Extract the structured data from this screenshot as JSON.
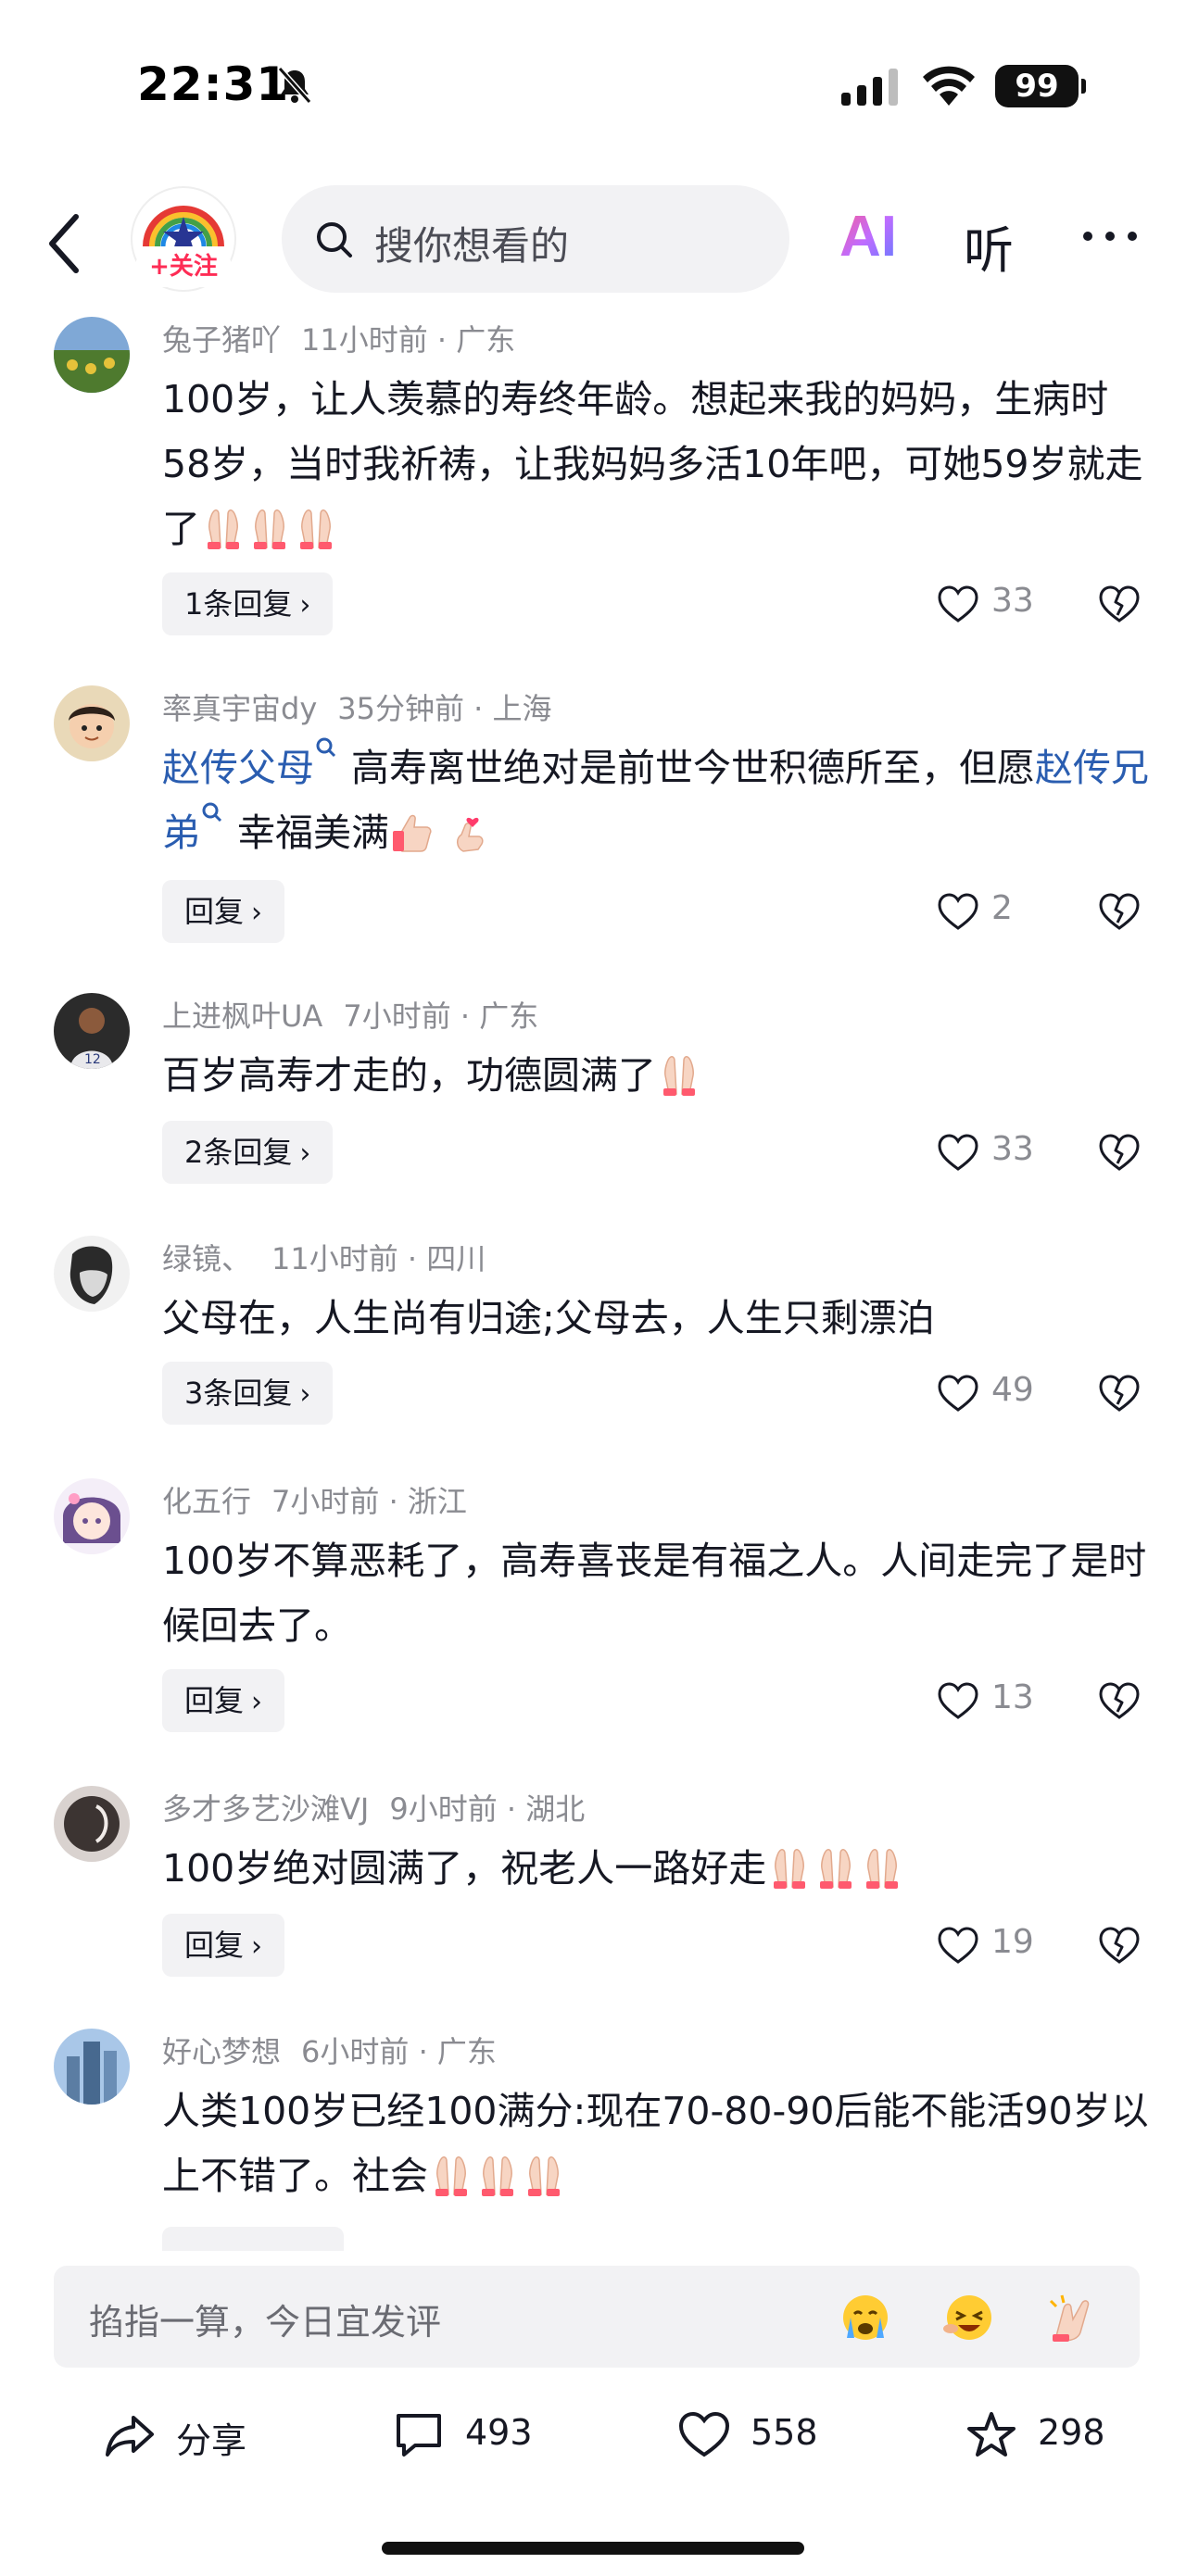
{
  "status_bar": {
    "time": "22:31",
    "battery": "99"
  },
  "top_nav": {
    "follow_label": "+关注",
    "search_placeholder": "搜你想看的",
    "ai_label": "AI",
    "listen_label": "听"
  },
  "comments": [
    {
      "author": "兔子猪吖",
      "time": "11小时前",
      "region": "广东",
      "text": "100岁，让人羡慕的寿终年龄。想起来我的妈妈，生病时58岁，当时我祈祷，让我妈妈多活10年吧，可她59岁就走了",
      "reply_label": "1条回复",
      "likes": "33"
    },
    {
      "author": "率真宇宙dy",
      "time": "35分钟前",
      "region": "上海",
      "link1": "赵传父母",
      "text1": "高寿离世绝对是前世今世积德所至，但愿",
      "link2": "赵传兄弟",
      "text2": "幸福美满",
      "reply_label": "回复",
      "likes": "2"
    },
    {
      "author": "上进枫叶UA",
      "time": "7小时前",
      "region": "广东",
      "text": "百岁高寿才走的，功德圆满了",
      "reply_label": "2条回复",
      "likes": "33"
    },
    {
      "author": "绿镜、",
      "time": "11小时前",
      "region": "四川",
      "text": "父母在，人生尚有归途;父母去，人生只剩漂泊",
      "reply_label": "3条回复",
      "likes": "49"
    },
    {
      "author": "化五行",
      "time": "7小时前",
      "region": "浙江",
      "text": "100岁不算恶耗了，高寿喜丧是有福之人。人间走完了是时候回去了。",
      "reply_label": "回复",
      "likes": "13"
    },
    {
      "author": "多才多艺沙滩VJ",
      "time": "9小时前",
      "region": "湖北",
      "text": "100岁绝对圆满了，祝老人一路好走",
      "reply_label": "回复",
      "likes": "19"
    },
    {
      "author": "好心梦想",
      "time": "6小时前",
      "region": "广东",
      "text": "人类100岁已经100满分:现在70-80-90后能不能活90岁以上不错了。社会"
    }
  ],
  "input": {
    "placeholder": "掐指一算，今日宜发评"
  },
  "actions": {
    "share": "分享",
    "comments": "493",
    "likes": "558",
    "favorites": "298"
  },
  "colors": {
    "accent": "#fe2c55",
    "link": "#2a5db0",
    "muted": "#8a8b91",
    "surface": "#f2f2f4"
  }
}
